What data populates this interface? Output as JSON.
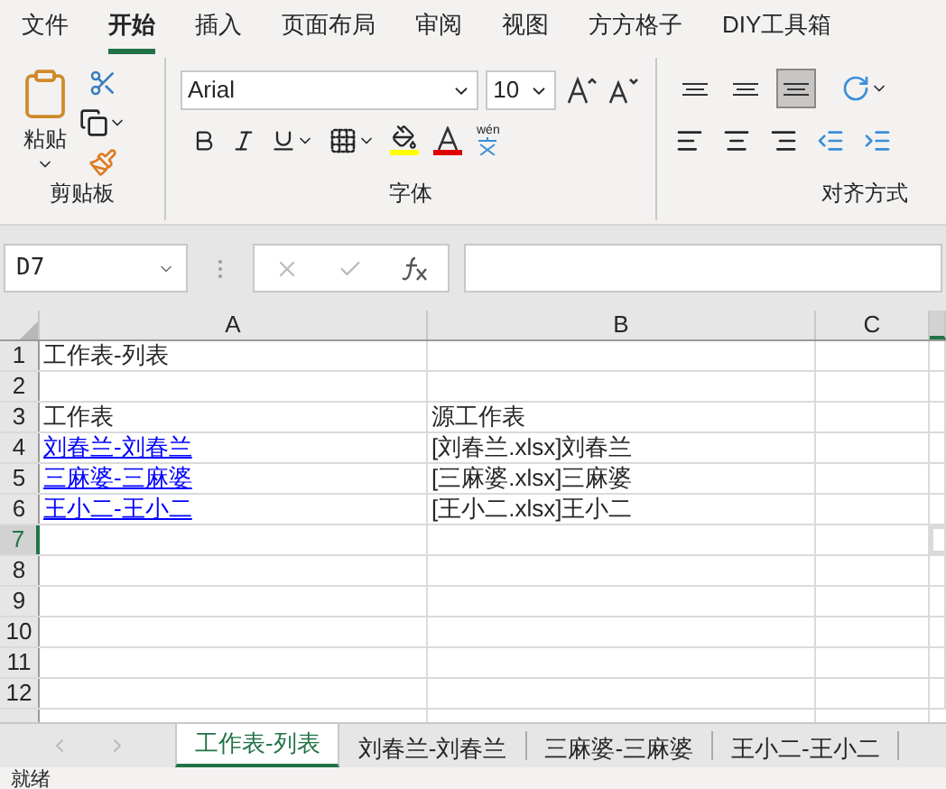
{
  "menu_tabs": [
    {
      "label": "文件",
      "selected": false
    },
    {
      "label": "开始",
      "selected": true
    },
    {
      "label": "插入",
      "selected": false
    },
    {
      "label": "页面布局",
      "selected": false
    },
    {
      "label": "审阅",
      "selected": false
    },
    {
      "label": "视图",
      "selected": false
    },
    {
      "label": "方方格子",
      "selected": false
    },
    {
      "label": "DIY工具箱",
      "selected": false
    }
  ],
  "clipboard": {
    "paste_label": "粘贴",
    "group_label": "剪贴板"
  },
  "font": {
    "name": "Arial",
    "size": "10",
    "group_label": "字体",
    "phonetic_label": "wén"
  },
  "alignment": {
    "group_label": "对齐方式",
    "vertical_buttons": [
      {
        "selected": false
      },
      {
        "selected": false
      },
      {
        "selected": true
      }
    ]
  },
  "name_box": "D7",
  "columns": [
    {
      "label": "A",
      "selected": false
    },
    {
      "label": "B",
      "selected": false
    },
    {
      "label": "C",
      "selected": false
    },
    {
      "selected": true
    }
  ],
  "rows": [
    {
      "number": "1",
      "selected": false,
      "cells": [
        {
          "kind": "text",
          "text": "工作表-列表"
        }
      ]
    },
    {
      "number": "2",
      "selected": false,
      "cells": []
    },
    {
      "number": "3",
      "selected": false,
      "cells": [
        {
          "kind": "text",
          "text": "工作表"
        },
        {
          "kind": "text",
          "text": "源工作表"
        }
      ]
    },
    {
      "number": "4",
      "selected": false,
      "cells": [
        {
          "kind": "link",
          "text": "刘春兰-刘春兰"
        },
        {
          "kind": "text",
          "text": "[刘春兰.xlsx]刘春兰"
        }
      ]
    },
    {
      "number": "5",
      "selected": false,
      "cells": [
        {
          "kind": "link",
          "text": "三麻婆-三麻婆"
        },
        {
          "kind": "text",
          "text": "[三麻婆.xlsx]三麻婆"
        }
      ]
    },
    {
      "number": "6",
      "selected": false,
      "cells": [
        {
          "kind": "link",
          "text": "王小二-王小二"
        },
        {
          "kind": "text",
          "text": "[王小二.xlsx]王小二"
        }
      ]
    },
    {
      "number": "7",
      "selected": true,
      "cells": []
    },
    {
      "number": "8",
      "selected": false,
      "cells": []
    },
    {
      "number": "9",
      "selected": false,
      "cells": []
    },
    {
      "number": "10",
      "selected": false,
      "cells": []
    },
    {
      "number": "11",
      "selected": false,
      "cells": []
    },
    {
      "number": "12",
      "selected": false,
      "cells": []
    }
  ],
  "sheet_tabs": [
    {
      "label": "工作表-列表",
      "selected": true
    },
    {
      "label": "刘春兰-刘春兰",
      "selected": false
    },
    {
      "label": "三麻婆-三麻婆",
      "selected": false
    },
    {
      "label": "王小二-王小二",
      "selected": false
    }
  ],
  "status_bar": {
    "text": "就绪"
  }
}
